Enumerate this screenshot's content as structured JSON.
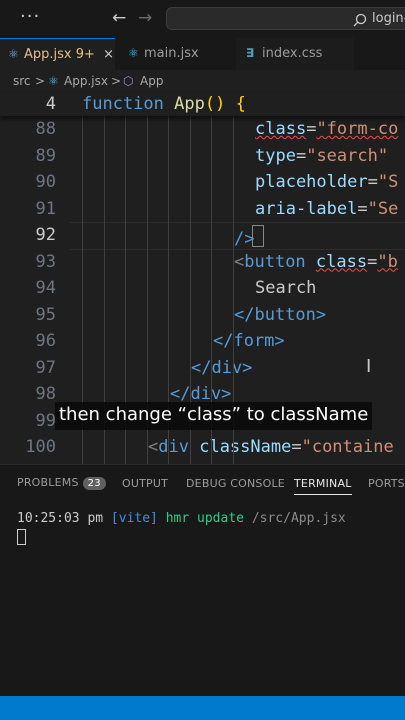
{
  "titlebar": {
    "menu_icon": "more-horizontal-icon",
    "back_icon": "arrow-left-icon",
    "forward_icon": "arrow-right-icon",
    "search_icon": "search-icon",
    "search_text": "login-a"
  },
  "tabs": [
    {
      "label": "App.jsx",
      "icon": "react-icon",
      "modified": "9+",
      "close": "×",
      "active": true
    },
    {
      "label": "main.jsx",
      "icon": "react-icon",
      "active": false
    },
    {
      "label": "index.css",
      "icon": "css-icon",
      "active": false
    }
  ],
  "breadcrumb": {
    "folder": "src",
    "file": "App.jsx",
    "symbol": "App",
    "separator": ">"
  },
  "editor": {
    "sticky_line": {
      "number": "4",
      "keyword": "function",
      "name": "App",
      "rest": "() {"
    },
    "lines": [
      {
        "number": "88",
        "attr": "class",
        "value": "\"form-co"
      },
      {
        "number": "89",
        "attr": "type",
        "value": "\"search\""
      },
      {
        "number": "90",
        "attr": "placeholder",
        "value": "\"S"
      },
      {
        "number": "91",
        "attr": "aria-label",
        "value": "\"Se"
      },
      {
        "number": "92",
        "text": "/>"
      },
      {
        "number": "93",
        "tag_open": "<",
        "tag": "button",
        "attr": "class",
        "value": "\"b"
      },
      {
        "number": "94",
        "text": "Search"
      },
      {
        "number": "95",
        "text": "</button>"
      },
      {
        "number": "96",
        "text": "</form>"
      },
      {
        "number": "97",
        "text": "</div>"
      },
      {
        "number": "98",
        "text": "</div>"
      },
      {
        "number": "99",
        "text": ""
      },
      {
        "number": "100",
        "tag": "div",
        "attr": "className",
        "value": "\"containe"
      }
    ],
    "current_line": "92"
  },
  "caption": "then change “class”  to className",
  "panel": {
    "tabs": [
      {
        "label": "PROBLEMS",
        "badge": "23"
      },
      {
        "label": "OUTPUT"
      },
      {
        "label": "DEBUG CONSOLE"
      },
      {
        "label": "TERMINAL",
        "active": true
      },
      {
        "label": "PORTS"
      }
    ],
    "terminal": {
      "time": "10:25:03 pm",
      "vite": "[vite]",
      "message": "hmr update",
      "path": "/src/App.jsx"
    }
  },
  "colors": {
    "accent": "#007acc",
    "keyword": "#569cd6",
    "string": "#ce9178",
    "attribute": "#9cdcfe"
  }
}
